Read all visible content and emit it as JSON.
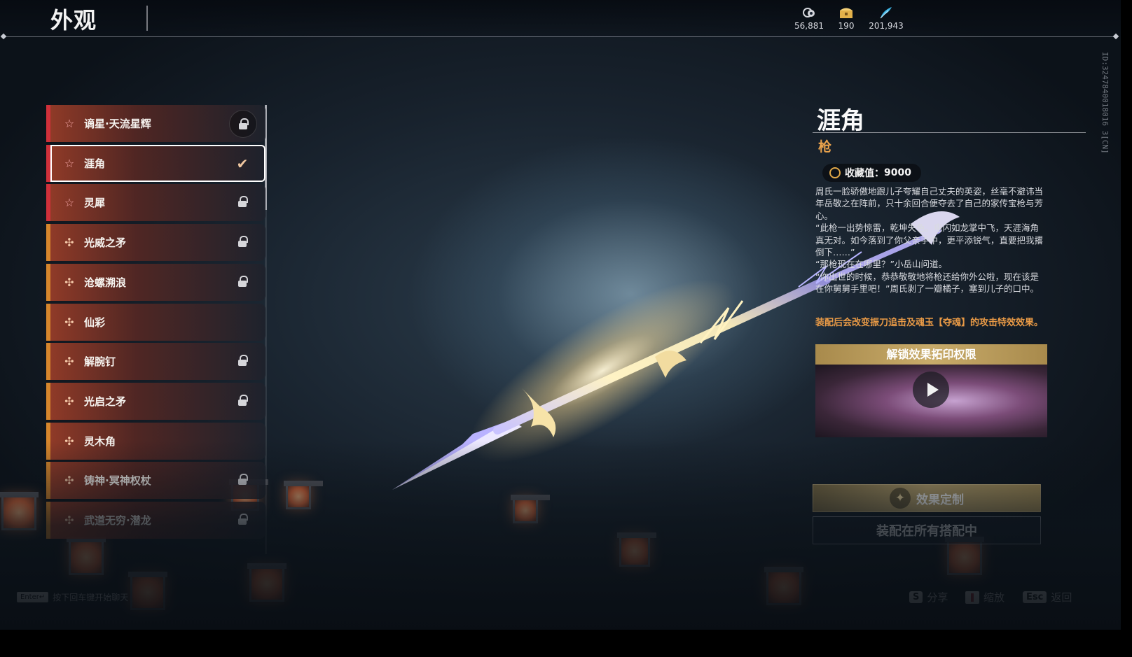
{
  "header": {
    "title": "外观",
    "currencies": [
      {
        "icon": "coin-swirl-icon",
        "value": "56,881"
      },
      {
        "icon": "gold-chest-icon",
        "value": "190"
      },
      {
        "icon": "blue-feather-icon",
        "value": "201,943"
      }
    ],
    "uid": "ID:3247840018016 3[CN]"
  },
  "list": {
    "items": [
      {
        "name": "谪星·天流星辉",
        "rarity": "red",
        "icon": "star-outline-icon",
        "state": "locked"
      },
      {
        "name": "涯角",
        "rarity": "red",
        "icon": "star-outline-icon",
        "state": "equipped"
      },
      {
        "name": "灵犀",
        "rarity": "red",
        "icon": "star-outline-icon",
        "state": "locked"
      },
      {
        "name": "光威之矛",
        "rarity": "gold",
        "icon": "cross-flower-icon",
        "state": "locked"
      },
      {
        "name": "沧螺溯浪",
        "rarity": "gold",
        "icon": "cross-flower-icon",
        "state": "locked"
      },
      {
        "name": "仙彩",
        "rarity": "gold",
        "icon": "cross-flower-icon",
        "state": "none"
      },
      {
        "name": "解腕钉",
        "rarity": "gold",
        "icon": "cross-flower-icon",
        "state": "locked"
      },
      {
        "name": "光启之矛",
        "rarity": "gold",
        "icon": "cross-flower-icon",
        "state": "locked"
      },
      {
        "name": "灵木角",
        "rarity": "gold",
        "icon": "cross-flower-icon",
        "state": "none"
      },
      {
        "name": "铸神·冥神权杖",
        "rarity": "gold",
        "icon": "cross-flower-icon",
        "state": "locked"
      },
      {
        "name": "武道无穷·潜龙",
        "rarity": "gold",
        "icon": "cross-flower-icon",
        "state": "locked"
      }
    ]
  },
  "detail": {
    "name": "涯角",
    "type": "枪",
    "collection_label": "收藏值：",
    "collection_value": "9000",
    "lore": [
      "周氏一脸骄傲地跟儿子夸耀自己丈夫的英姿，丝毫不避讳当年岳敬之在阵前，只十余回合便夺去了自己的家传宝枪与芳心。",
      "“此枪一出势惊雷，乾坤失色。电闪如龙掌中飞，天涯海角真无对。如今落到了你父亲手中，更平添锐气，直要把我撂倒下……”",
      "“那枪现在在哪里？”小岳山问道。",
      "“你出世的时候，恭恭敬敬地将枪还给你外公啦，现在该是在你舅舅手里吧！”周氏剥了一瓣橘子，塞到儿子的口中。"
    ],
    "effect_note": "装配后会改变振刀追击及魂玉【夺魂】的攻击特效效果。",
    "preview_title": "解锁效果拓印权限",
    "custom_button": "效果定制",
    "equip_all_button": "装配在所有搭配中"
  },
  "footer": {
    "chat_key": "Enter↵",
    "chat_hint": "按下回车键开始聊天",
    "share_key": "S",
    "share_label": "分享",
    "zoom_label": "缩放",
    "back_key": "Esc",
    "back_label": "返回"
  },
  "colors": {
    "accent_gold": "#e9a24c",
    "rarity_red": "#d0303a",
    "rarity_gold": "#d6862c"
  }
}
